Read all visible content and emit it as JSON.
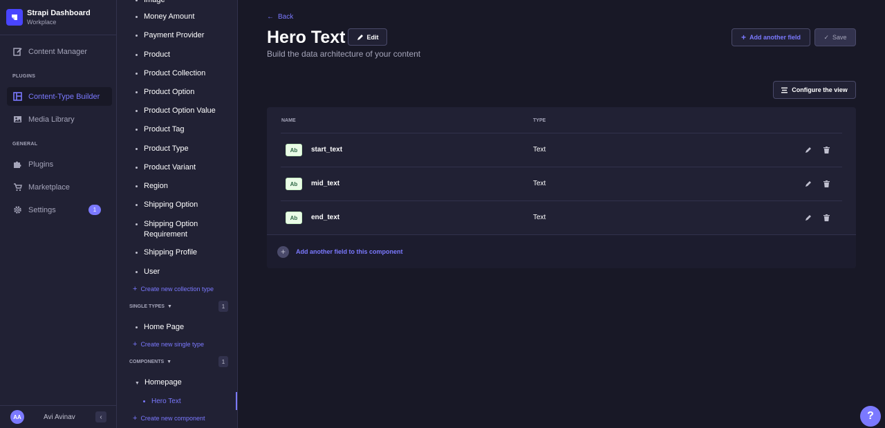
{
  "brand": {
    "title": "Strapi Dashboard",
    "subtitle": "Workplace"
  },
  "mainnav": {
    "content_manager": "Content Manager",
    "plugins_section": "PLUGINS",
    "content_type_builder": "Content-Type Builder",
    "media_library": "Media Library",
    "general_section": "GENERAL",
    "plugins": "Plugins",
    "marketplace": "Marketplace",
    "settings": "Settings",
    "settings_badge": "1"
  },
  "profile": {
    "initials": "AA",
    "name": "Avi Avinav"
  },
  "subnav": {
    "partial_top": "Image",
    "collection_types": [
      "Money Amount",
      "Payment Provider",
      "Product",
      "Product Collection",
      "Product Option",
      "Product Option Value",
      "Product Tag",
      "Product Type",
      "Product Variant",
      "Region",
      "Shipping Option",
      "Shipping Option Requirement",
      "Shipping Profile",
      "User"
    ],
    "create_collection": "Create new collection type",
    "single_types_label": "SINGLE TYPES",
    "single_types_count": "1",
    "single_types": [
      "Home Page"
    ],
    "create_single": "Create new single type",
    "components_label": "COMPONENTS",
    "components_count": "1",
    "component_category": "Homepage",
    "component_active": "Hero Text",
    "create_component": "Create new component"
  },
  "header": {
    "back": "Back",
    "title": "Hero Text",
    "edit": "Edit",
    "subtitle": "Build the data architecture of your content",
    "add_field": "Add another field",
    "save": "Save",
    "configure": "Configure the view"
  },
  "table": {
    "col_name": "NAME",
    "col_type": "TYPE",
    "rows": [
      {
        "icon": "Ab",
        "name": "start_text",
        "type": "Text"
      },
      {
        "icon": "Ab",
        "name": "mid_text",
        "type": "Text"
      },
      {
        "icon": "Ab",
        "name": "end_text",
        "type": "Text"
      }
    ],
    "footer_add": "Add another field to this component"
  },
  "help": "?",
  "colors": {
    "accent": "#7b79ff",
    "brand": "#4945ff",
    "background": "#181826",
    "panel": "#212134"
  }
}
